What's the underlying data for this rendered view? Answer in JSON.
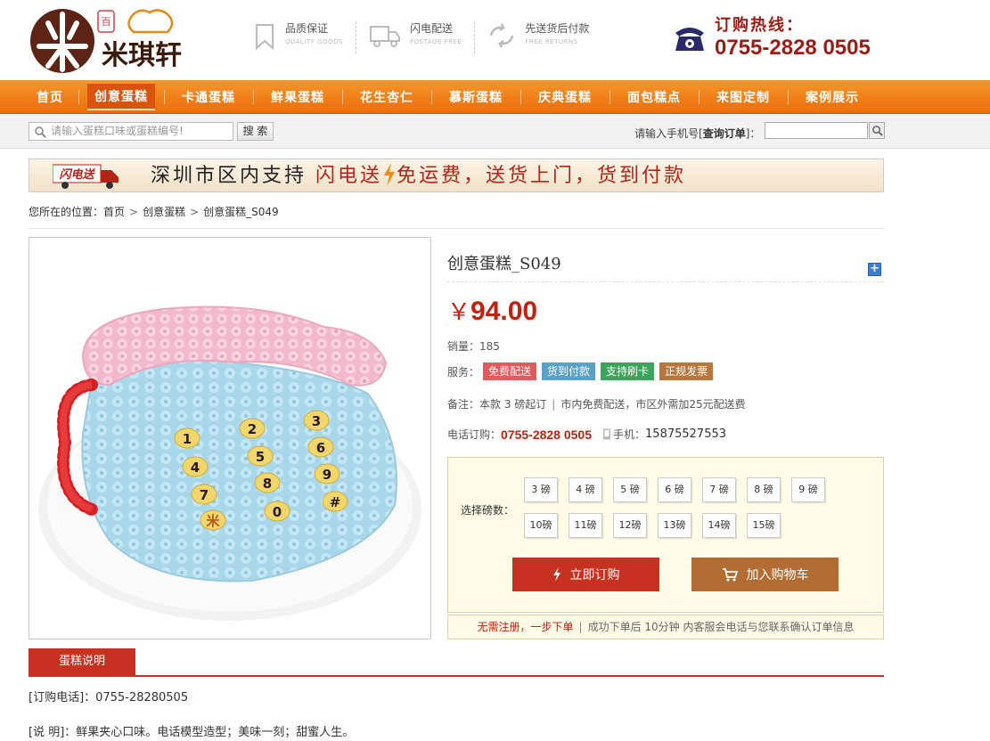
{
  "header": {
    "logo_text": "米琪轩",
    "features": [
      {
        "icon": "bookmark-icon",
        "title": "品质保证",
        "sub": "QUALITY GOODS"
      },
      {
        "icon": "truck-icon",
        "title": "闪电配送",
        "sub": "POSTAGE FREE"
      },
      {
        "icon": "exchange-icon",
        "title": "先送货后付款",
        "sub": "FREE RETURNS"
      }
    ],
    "hotline_label": "订购热线：",
    "hotline_number": "0755-2828 0505"
  },
  "nav": {
    "items": [
      "首页",
      "创意蛋糕",
      "卡通蛋糕",
      "鲜果蛋糕",
      "花生杏仁",
      "慕斯蛋糕",
      "庆典蛋糕",
      "面包糕点",
      "来图定制",
      "案例展示"
    ],
    "active_index": 1
  },
  "search": {
    "placeholder": "请输入蛋糕口味或蛋糕编号!",
    "button": "搜 索",
    "query_label_prefix": "请输入手机号[",
    "query_label_bold": "查询订单",
    "query_label_suffix": "]："
  },
  "banner": {
    "badge": "闪电送",
    "text_a": "深圳市区内支持",
    "text_b": "闪电送",
    "text_c": "免运费，送货上门，货到付款"
  },
  "breadcrumb": {
    "prefix": "您所在的位置：",
    "items": [
      "首页",
      "创意蛋糕",
      "创意蛋糕_S049"
    ],
    "separator": ">"
  },
  "product": {
    "title": "创意蛋糕_S049",
    "currency": "￥",
    "price": "94.00",
    "sales_label": "销量：",
    "sales": "185",
    "service_label": "服务：",
    "services": [
      {
        "label": "免费配送",
        "color": "#e05b5b"
      },
      {
        "label": "货到付款",
        "color": "#5aa1c8"
      },
      {
        "label": "支持刷卡",
        "color": "#3aa55a"
      },
      {
        "label": "正规发票",
        "color": "#b8763c"
      }
    ],
    "note_label": "备注：",
    "note_a": "本款 3 磅起订",
    "note_b": "市内免费配送，市区外需加25元配送费",
    "phone_label": "电话订购：",
    "phone": "0755-2828 0505",
    "mobile_label": "手机：",
    "mobile": "15875527553"
  },
  "order": {
    "size_label": "选择磅数：",
    "sizes_row1": [
      "3 磅",
      "4 磅",
      "5 磅",
      "6 磅",
      "7 磅",
      "8 磅",
      "9 磅"
    ],
    "sizes_row2": [
      "10磅",
      "11磅",
      "12磅",
      "13磅",
      "14磅",
      "15磅"
    ],
    "buy_now": "立即订购",
    "add_cart": "加入购物车",
    "note_highlight": "无需注册，一步下单",
    "note_rest": "成功下单后 10分钟 内客服会电话与您联系确认订单信息"
  },
  "details": {
    "tab": "蛋糕说明",
    "line1": "[订购电话]：0755-28280505",
    "line2": "[说 明]：鲜果夹心口味。电话模型造型；美味一刻；甜蜜人生。"
  },
  "colors": {
    "brand_red": "#c1210d",
    "nav_orange": "#f07d14",
    "order_bg": "#fefbe6"
  }
}
